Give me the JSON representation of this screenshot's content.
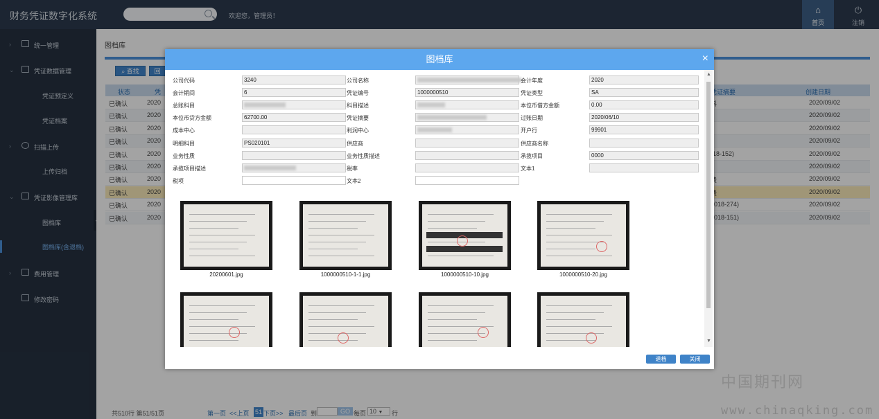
{
  "app": {
    "title": "财务凭证数字化系统",
    "welcome": "欢迎您，管理员！"
  },
  "topnav": {
    "home_label": "首页",
    "logout_label": "注销"
  },
  "sidebar": {
    "items": [
      {
        "label": "统一管理"
      },
      {
        "label": "凭证数据管理"
      },
      {
        "label": "凭证预定义"
      },
      {
        "label": "凭证档案"
      },
      {
        "label": "扫描上传"
      },
      {
        "label": "上传归档"
      },
      {
        "label": "凭证影像管理库"
      },
      {
        "label": "图档库"
      },
      {
        "label": "图档库(含退档)"
      },
      {
        "label": "费用管理"
      },
      {
        "label": "修改密码"
      }
    ],
    "collapse_glyph": "«"
  },
  "main": {
    "title": "图档库",
    "query_button": "查找",
    "second_button": "回",
    "table": {
      "headers": [
        "状态",
        "凭",
        "凭证摘要",
        "创建日期"
      ],
      "rows": [
        {
          "status": "已确认",
          "year": "2020",
          "summary": "料",
          "date": "2020/09/02"
        },
        {
          "status": "已确认",
          "year": "2020",
          "summary": "",
          "date": "2020/09/02"
        },
        {
          "status": "已确认",
          "year": "2020",
          "summary": "",
          "date": "2020/09/02"
        },
        {
          "status": "已确认",
          "year": "2020",
          "summary": "",
          "date": "2020/09/02"
        },
        {
          "status": "已确认",
          "year": "2020",
          "summary": "(18-152)",
          "date": "2020/09/02"
        },
        {
          "status": "已确认",
          "year": "2020",
          "summary": "",
          "date": "2020/09/02"
        },
        {
          "status": "已确认",
          "year": "2020",
          "summary": "费",
          "date": "2020/09/02"
        },
        {
          "status": "已确认",
          "year": "2020",
          "summary": "费",
          "date": "2020/09/02"
        },
        {
          "status": "已确认",
          "year": "2020",
          "summary": "2018-274)",
          "date": "2020/09/02"
        },
        {
          "status": "已确认",
          "year": "2020",
          "summary": "2018-151)",
          "date": "2020/09/02"
        }
      ]
    },
    "pager": {
      "summary": "共510行 第51/51页",
      "first": "第一页",
      "prev": "<<上页",
      "current": "51",
      "next": "下页>>",
      "last": "最后页",
      "goto": "到",
      "go_button": "GO",
      "per_page": "每页",
      "per_page_value": "10",
      "rows_unit": "行"
    }
  },
  "modal": {
    "title": "图档库",
    "close_glyph": "×",
    "fields": {
      "company_code": {
        "label": "公司代码",
        "value": "3240"
      },
      "company_name": {
        "label": "公司名称",
        "value": ""
      },
      "fiscal_year": {
        "label": "会计年度",
        "value": "2020"
      },
      "period": {
        "label": "会计期间",
        "value": "6"
      },
      "voucher_no": {
        "label": "凭证编号",
        "value": "1000000510"
      },
      "voucher_type": {
        "label": "凭证类型",
        "value": "SA"
      },
      "gl_account": {
        "label": "总账科目",
        "value": ""
      },
      "account_desc": {
        "label": "科目描述",
        "value": ""
      },
      "local_debit": {
        "label": "本位币借方金额",
        "value": "0.00"
      },
      "local_credit": {
        "label": "本位币贷方金额",
        "value": "62700.00"
      },
      "voucher_summary": {
        "label": "凭证摘要",
        "value": ""
      },
      "posting_date": {
        "label": "过账日期",
        "value": "2020/06/10"
      },
      "cost_center": {
        "label": "成本中心",
        "value": ""
      },
      "profit_center": {
        "label": "利润中心",
        "value": ""
      },
      "bank": {
        "label": "开户行",
        "value": "99901"
      },
      "detail_account": {
        "label": "明细科目",
        "value": "PS020101"
      },
      "supplier": {
        "label": "供应商",
        "value": ""
      },
      "supplier_name": {
        "label": "供应商名称",
        "value": ""
      },
      "business_nature": {
        "label": "业务性质",
        "value": ""
      },
      "business_nature_desc": {
        "label": "业务性质描述",
        "value": ""
      },
      "contract_item": {
        "label": "承揽项目",
        "value": "0000"
      },
      "contract_item_desc": {
        "label": "承揽项目描述",
        "value": ""
      },
      "tax_rate": {
        "label": "税率",
        "value": ""
      },
      "text1": {
        "label": "文本1",
        "value": ""
      },
      "tax_item": {
        "label": "税项",
        "value": ""
      },
      "text2": {
        "label": "文本2",
        "value": ""
      }
    },
    "images": [
      {
        "name": "20200601.jpg"
      },
      {
        "name": "1000000510-1-1.jpg"
      },
      {
        "name": "1000000510-10.jpg"
      },
      {
        "name": "1000000510-20.jpg"
      },
      {
        "name": ""
      },
      {
        "name": ""
      },
      {
        "name": ""
      },
      {
        "name": ""
      }
    ],
    "return_button": "退档",
    "close_button": "关闭"
  },
  "watermark": {
    "line1": "中国期刊网",
    "line2": "www.chinaqking.com"
  }
}
